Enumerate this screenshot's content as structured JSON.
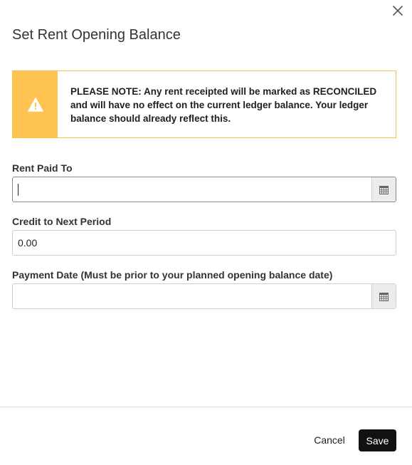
{
  "dialog": {
    "title": "Set Rent Opening Balance",
    "close_icon": "close-icon"
  },
  "alert": {
    "icon": "warning-icon",
    "message": "PLEASE NOTE: Any rent receipted will be marked as RECONCILED and will have no effect on the current ledger balance. Your ledger balance should already reflect this."
  },
  "fields": {
    "rent_paid_to": {
      "label": "Rent Paid To",
      "value": "",
      "icon": "calendar-icon"
    },
    "credit_next_period": {
      "label": "Credit to Next Period",
      "value": "0.00"
    },
    "payment_date": {
      "label": "Payment Date (Must be prior to your planned opening balance date)",
      "value": "",
      "icon": "calendar-icon"
    }
  },
  "footer": {
    "cancel_label": "Cancel",
    "save_label": "Save"
  },
  "colors": {
    "alert_accent": "#fec350",
    "primary_button": "#111111"
  }
}
